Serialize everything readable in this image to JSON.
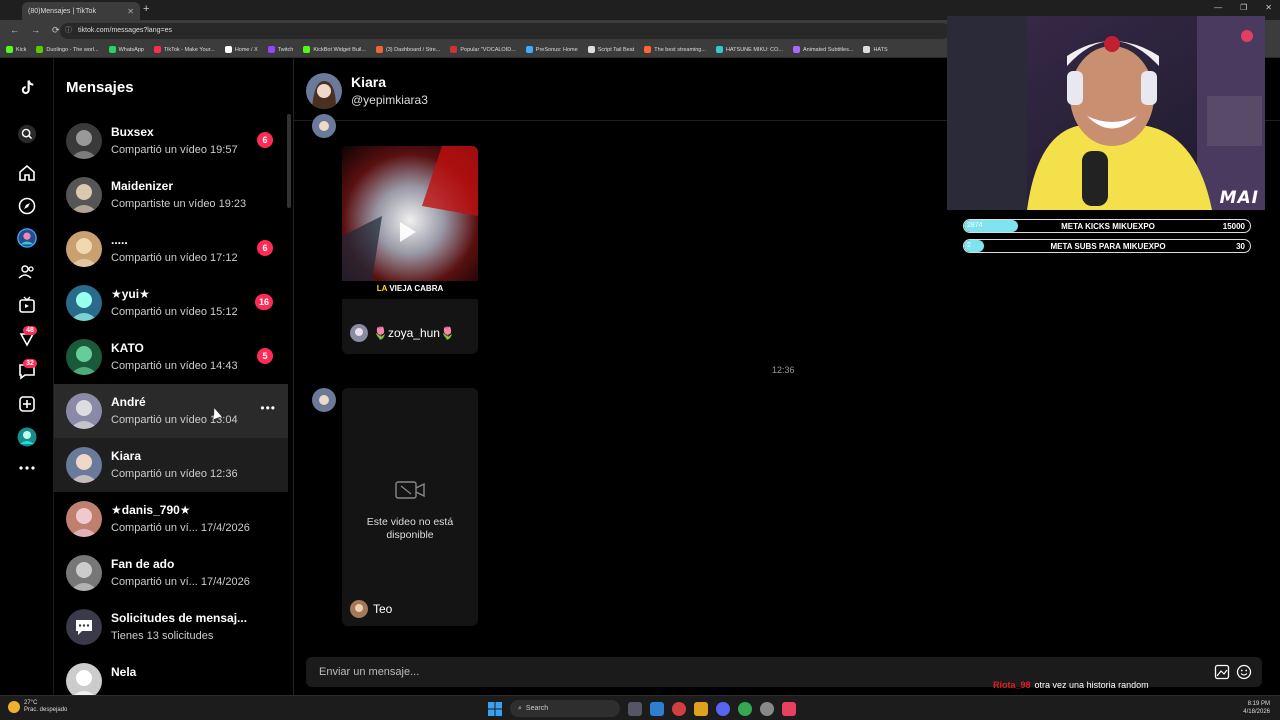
{
  "browser": {
    "tab_title": "(80)Mensajes | TikTok",
    "url": "tiktok.com/messages?lang=es",
    "bookmarks": [
      "Kick",
      "Duolingo - The worl...",
      "WhatsApp",
      "TikTok - Make Your...",
      "Home / X",
      "Twitch",
      "KickBot Widget Buil...",
      "(3) Dashboard / Stre...",
      "Popular \"VOCALOID...",
      "PreSonus: Home",
      "Script Tail Beat",
      "The best streaming...",
      "HATSUNE MIKU: CO...",
      "Animated Subtitles...",
      "HATS"
    ]
  },
  "rail": {
    "badge_notifications": "48",
    "badge_messages": "32"
  },
  "conversations": {
    "title": "Mensajes",
    "items": [
      {
        "name": "Buxsex",
        "preview": "Compartió un vídeo 19:57",
        "badge": "6"
      },
      {
        "name": "Maidenizer",
        "preview": "Compartiste un vídeo 19:23",
        "badge": ""
      },
      {
        "name": ".....",
        "preview": "Compartió un vídeo 17:12",
        "badge": "6"
      },
      {
        "name": "★yui★",
        "preview": "Compartió un vídeo 15:12",
        "badge": "16"
      },
      {
        "name": "KATO",
        "preview": "Compartió un vídeo 14:43",
        "badge": "5"
      },
      {
        "name": "André",
        "preview": "Compartió un vídeo 13:04",
        "badge": ""
      },
      {
        "name": "Kiara",
        "preview": "Compartió un vídeo 12:36",
        "badge": ""
      },
      {
        "name": "★danis_790★",
        "preview": "Compartió un ví... 17/4/2026",
        "badge": ""
      },
      {
        "name": "Fan de ado",
        "preview": "Compartió un ví... 17/4/2026",
        "badge": ""
      },
      {
        "name": "Solicitudes de mensaj...",
        "preview": "Tienes 13 solicitudes",
        "badge": ""
      },
      {
        "name": "Nela",
        "preview": "",
        "badge": ""
      }
    ]
  },
  "chat": {
    "name": "Kiara",
    "handle": "@yepimkiara3",
    "video1": {
      "caption_a": "LA",
      "caption_b": "VIEJA CABRA",
      "author": "🌷zoya_hun🌷"
    },
    "timestamp": "12:36",
    "video2": {
      "unavailable": "Este video no está disponible",
      "author": "Teo"
    },
    "input_placeholder": "Enviar un mensaje..."
  },
  "overlay": {
    "cam_logo": "MAI",
    "goals": [
      {
        "current": "2874",
        "label": "META KICKS MIKUEXPO",
        "target": "15000",
        "progress": 0.19
      },
      {
        "current": "2",
        "label": "META SUBS PARA MIKUEXPO",
        "target": "30",
        "progress": 0.07
      }
    ],
    "chat_user": "Riota_98",
    "chat_message": "otra vez una historia random"
  },
  "taskbar": {
    "weather_temp": "27°C",
    "weather_desc": "Prac. despejado",
    "search": "Search",
    "time": "8:19 PM",
    "date": "4/18/2026"
  },
  "colors": {
    "accent": "#fe2c55",
    "goal_fill": "#7fe3f0"
  }
}
